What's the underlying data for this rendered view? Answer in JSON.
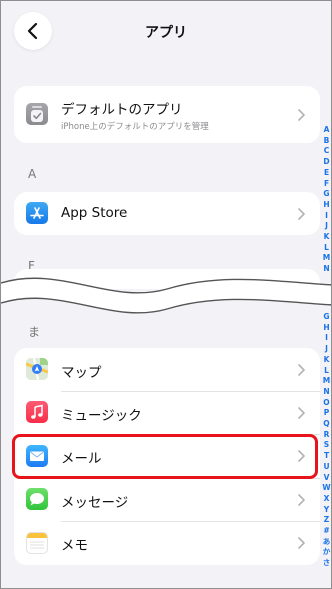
{
  "header": {
    "title": "アプリ",
    "back_icon": "chevron-left-icon"
  },
  "defaults_card": {
    "label": "デフォルトのアプリ",
    "subtitle": "iPhone上のデフォルトのアプリを管理",
    "icon": "default-apps-icon"
  },
  "sections": {
    "a": "A",
    "f": "F",
    "ma": "ま"
  },
  "apps_a": [
    {
      "label": "App Store",
      "icon": "app-store-icon"
    }
  ],
  "apps_ma": [
    {
      "label": "マップ",
      "icon": "maps-icon"
    },
    {
      "label": "ミュージック",
      "icon": "music-icon"
    },
    {
      "label": "メール",
      "icon": "mail-icon"
    },
    {
      "label": "メッセージ",
      "icon": "messages-icon"
    },
    {
      "label": "メモ",
      "icon": "notes-icon"
    }
  ],
  "index_top": [
    "A",
    "B",
    "C",
    "D",
    "E",
    "F",
    "G",
    "H",
    "I",
    "J",
    "K",
    "L",
    "M",
    "N"
  ],
  "index_bottom": [
    "G",
    "H",
    "I",
    "J",
    "K",
    "L",
    "M",
    "N",
    "O",
    "P",
    "Q",
    "R",
    "S",
    "T",
    "U",
    "V",
    "W",
    "X",
    "Y",
    "Z",
    "#",
    "あ",
    "か",
    "さ"
  ],
  "colors": {
    "accent": "#1a73e8",
    "highlight": "#e8141b",
    "background": "#f2f2f7"
  }
}
